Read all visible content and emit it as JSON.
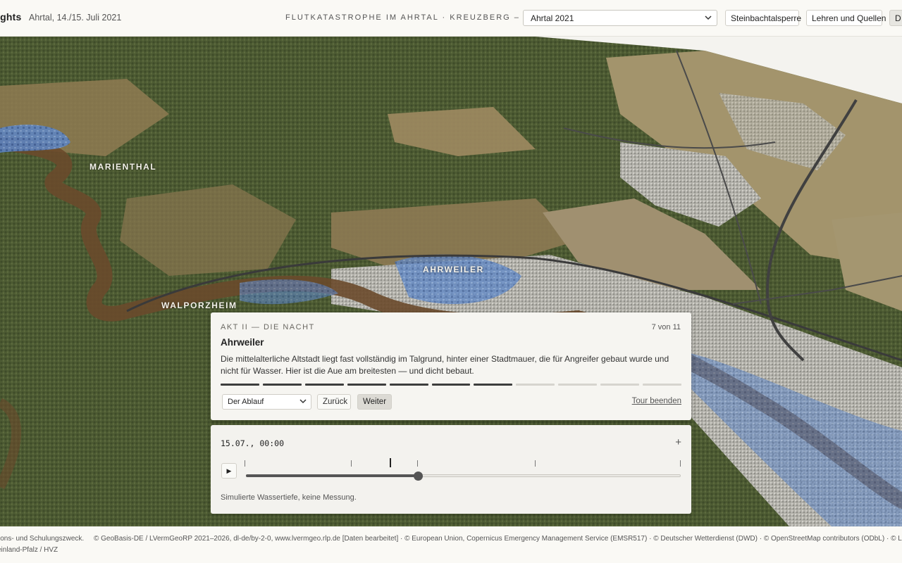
{
  "header": {
    "brand": "ights",
    "date": "Ahrtal, 14./15. Juli 2021",
    "breadcrumb": "FLUTKATASTROPHE IM AHRTAL · KREUZBERG – KRIPP",
    "scenario_select": "Ahrtal 2021",
    "buttons": {
      "steinbach": "Steinbachtalsperre",
      "lehren": "Lehren und Quellen",
      "edge": "D"
    }
  },
  "map": {
    "places": [
      "MARIENTHAL",
      "AHRWEILER",
      "WALPORZHEIM"
    ]
  },
  "story": {
    "act": "AKT II — DIE NACHT",
    "count": "7 von 11",
    "title": "Ahrweiler",
    "body": "Die mittelalterliche Altstadt liegt fast vollständig im Talgrund, hinter einer Stadtmauer, die für Angreifer gebaut wurde und nicht für Wasser. Hier ist die Aue am breitesten — und dicht bebaut.",
    "progress": {
      "total": 11,
      "completed": 7
    },
    "chapter_select": "Der Ablauf",
    "back_label": "Zurück",
    "next_label": "Weiter",
    "end_label": "Tour beenden"
  },
  "timeline": {
    "time": "15.07., 00:00",
    "expand_label": "+",
    "play_icon": "play-icon",
    "play_glyph": "▶",
    "position": 0.395,
    "note": "Simulierte Wassertiefe, keine Messung."
  },
  "footer": {
    "line1_left": "ions- und Schulungszweck.",
    "line1_attribution": "© GeoBasis-DE / LVermGeoRP 2021–2026, dl-de/by-2-0, www.lvermgeo.rlp.de [Daten bearbeitet] · © European Union, Copernicus Emergency Management Service (EMSR517) · © Deutscher Wetterdienst (DWD) · © OpenStreetMap contributors (ODbL) · © Landes",
    "line2": "einland-Pfalz / HVZ"
  },
  "colors": {
    "forest": "#4e5d34",
    "field": "#9c8c63",
    "river": "#6b4a2c",
    "water": "#5d86c7",
    "urban": "#a9a8a2",
    "progress_done": "#3d3d3d",
    "progress_todo": "#d6d4ce"
  }
}
